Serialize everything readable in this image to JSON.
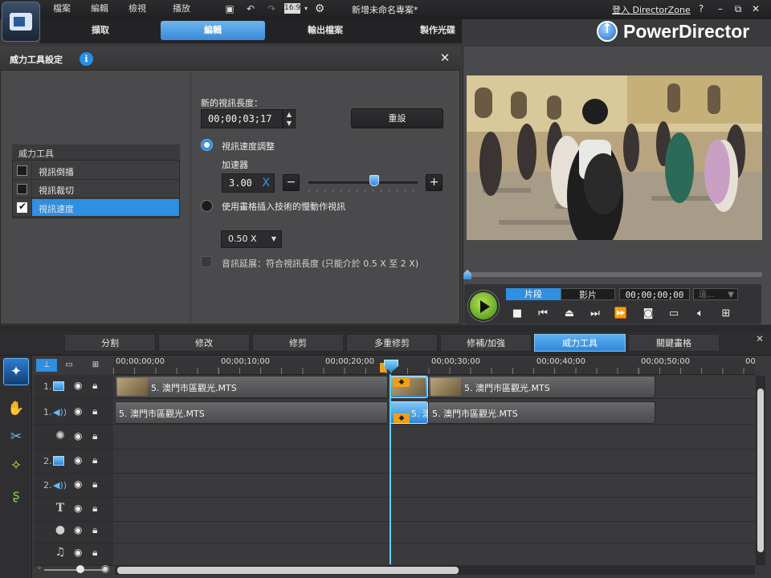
{
  "menu": {
    "file": "檔案",
    "edit": "編輯",
    "view": "檢視",
    "playback": "播放"
  },
  "toolbar": {
    "aspect_ratio": "16:9"
  },
  "window": {
    "project_title": "新增未命名專案*",
    "login_link": "登入 DirectorZone",
    "brand": "PowerDirector"
  },
  "modes": {
    "capture": "擷取",
    "edit": "編輯",
    "produce": "輸出檔案",
    "create_disc": "製作光碟"
  },
  "power_tool": {
    "title": "威力工具設定",
    "list_header": "威力工具",
    "items": [
      {
        "label": "視訊倒播",
        "checked": false
      },
      {
        "label": "視訊裁切",
        "checked": false
      },
      {
        "label": "視訊速度",
        "checked": true
      }
    ],
    "new_length_label": "新的視訊長度：",
    "new_length_value": "00;00;03;17",
    "reset_label": "重設",
    "speed_adjust_label": "視訊速度調整",
    "multiplier_label": "加速器",
    "multiplier_value": "3.00",
    "multiplier_unit": "X",
    "slider_level": 0.6,
    "frame_interp_label": "使用畫格插入技術的慢動作視訊",
    "rate_value": "0.50 X",
    "audio_stretch_label": "音訊延展：符合視訊長度 (只能介於 0.5 X 至 2 X)"
  },
  "preview": {
    "seg_clip": "片段",
    "seg_movie": "影片",
    "timecode": "00;00;00;00",
    "speed_placeholder": "這...",
    "progress": 0.0
  },
  "rooms": {
    "tabs": [
      "分割",
      "修改",
      "修剪",
      "多重修剪",
      "修補/加強",
      "威力工具",
      "關鍵畫格"
    ],
    "active_index": 5
  },
  "timeline": {
    "ruler_labels": [
      "00;00;00;00",
      "00;00;10;00",
      "00;00;20;00",
      "00;00;30;00",
      "00;00;40;00",
      "00;00;50;00",
      "00"
    ],
    "tracks": [
      {
        "num": "1.",
        "type": "video"
      },
      {
        "num": "1.",
        "type": "audio"
      },
      {
        "num": "",
        "type": "effect"
      },
      {
        "num": "2.",
        "type": "video"
      },
      {
        "num": "2.",
        "type": "audio"
      },
      {
        "num": "",
        "type": "title"
      },
      {
        "num": "",
        "type": "voice"
      },
      {
        "num": "",
        "type": "music"
      }
    ],
    "clips": {
      "video_left": "5. 澳門市區觀光.MTS",
      "video_right": "5. 澳門市區觀光.MTS",
      "audio_left": "5. 澳門市區觀光.MTS",
      "audio_mid": "5. 澳",
      "audio_right": "5. 澳門市區觀光.MTS"
    }
  },
  "colors": {
    "accent": "#2f8fe0",
    "panel": "#4a4a4c",
    "playhead": "#5cd2f4"
  }
}
